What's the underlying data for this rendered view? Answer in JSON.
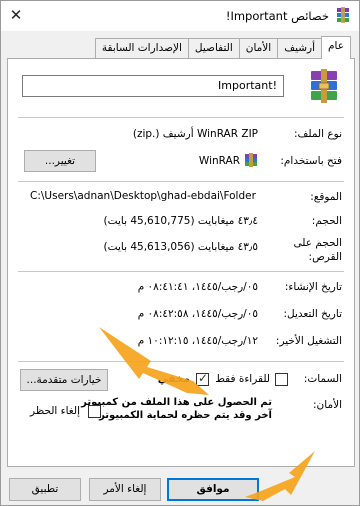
{
  "window": {
    "title": "خصائص Important!",
    "close_glyph": "✕"
  },
  "tabs": [
    {
      "label": "عام",
      "active": true
    },
    {
      "label": "أرشيف",
      "active": false
    },
    {
      "label": "الأمان",
      "active": false
    },
    {
      "label": "التفاصيل",
      "active": false
    },
    {
      "label": "الإصدارات السابقة",
      "active": false
    }
  ],
  "general": {
    "file_name": "Important!",
    "type_label": "نوع الملف:",
    "type_value": "WinRAR ZIP أرشيف (.zip)",
    "opens_with_label": "فتح باستخدام:",
    "opens_with_value": "WinRAR",
    "change_button": "تغيير...",
    "location_label": "الموقع:",
    "location_value": "C:\\Users\\adnan\\Desktop\\ghad-ebdai\\Folder",
    "size_label": "الحجم:",
    "size_value": "٤٣٫٤ ميغابايت (45,610,775 بايت)",
    "size_on_disk_label_1": "الحجم على",
    "size_on_disk_label_2": "القرص:",
    "size_on_disk_value": "٤٣٫٥ ميغابايت (45,613,056 بايت)",
    "created_label": "تاريخ الإنشاء:",
    "created_value": "٠٥/رجب/١٤٤٥، ٠٨:٤١:٤١ م",
    "modified_label": "تاريخ التعديل:",
    "modified_value": "٠٥/رجب/١٤٤٥، ٠٨:٤٢:٥٨ م",
    "accessed_label": "التشغيل الأخير:",
    "accessed_value": "١٢/رجب/١٤٤٥، ١٠:١٢:١٥ م",
    "attributes_label": "السمات:",
    "readonly_label": "للقراءة فقط",
    "readonly_checked": false,
    "hidden_label": "مخفي",
    "hidden_checked": true,
    "advanced_button": "خيارات متقدمة...",
    "security_label": "الأمان:",
    "security_text_1": "تم الحصول على هذا الملف من كمبيوتر",
    "security_text_2": "آخر وقد يتم حظره لحماية الكمبيوتر.",
    "unblock_label": "إلغاء الحظر",
    "unblock_checked": false
  },
  "footer": {
    "ok": "موافق",
    "cancel": "إلغاء الأمر",
    "apply": "تطبيق"
  },
  "colors": {
    "annotation_arrow": "#f5a41c",
    "focus_blue": "#0078d7"
  }
}
